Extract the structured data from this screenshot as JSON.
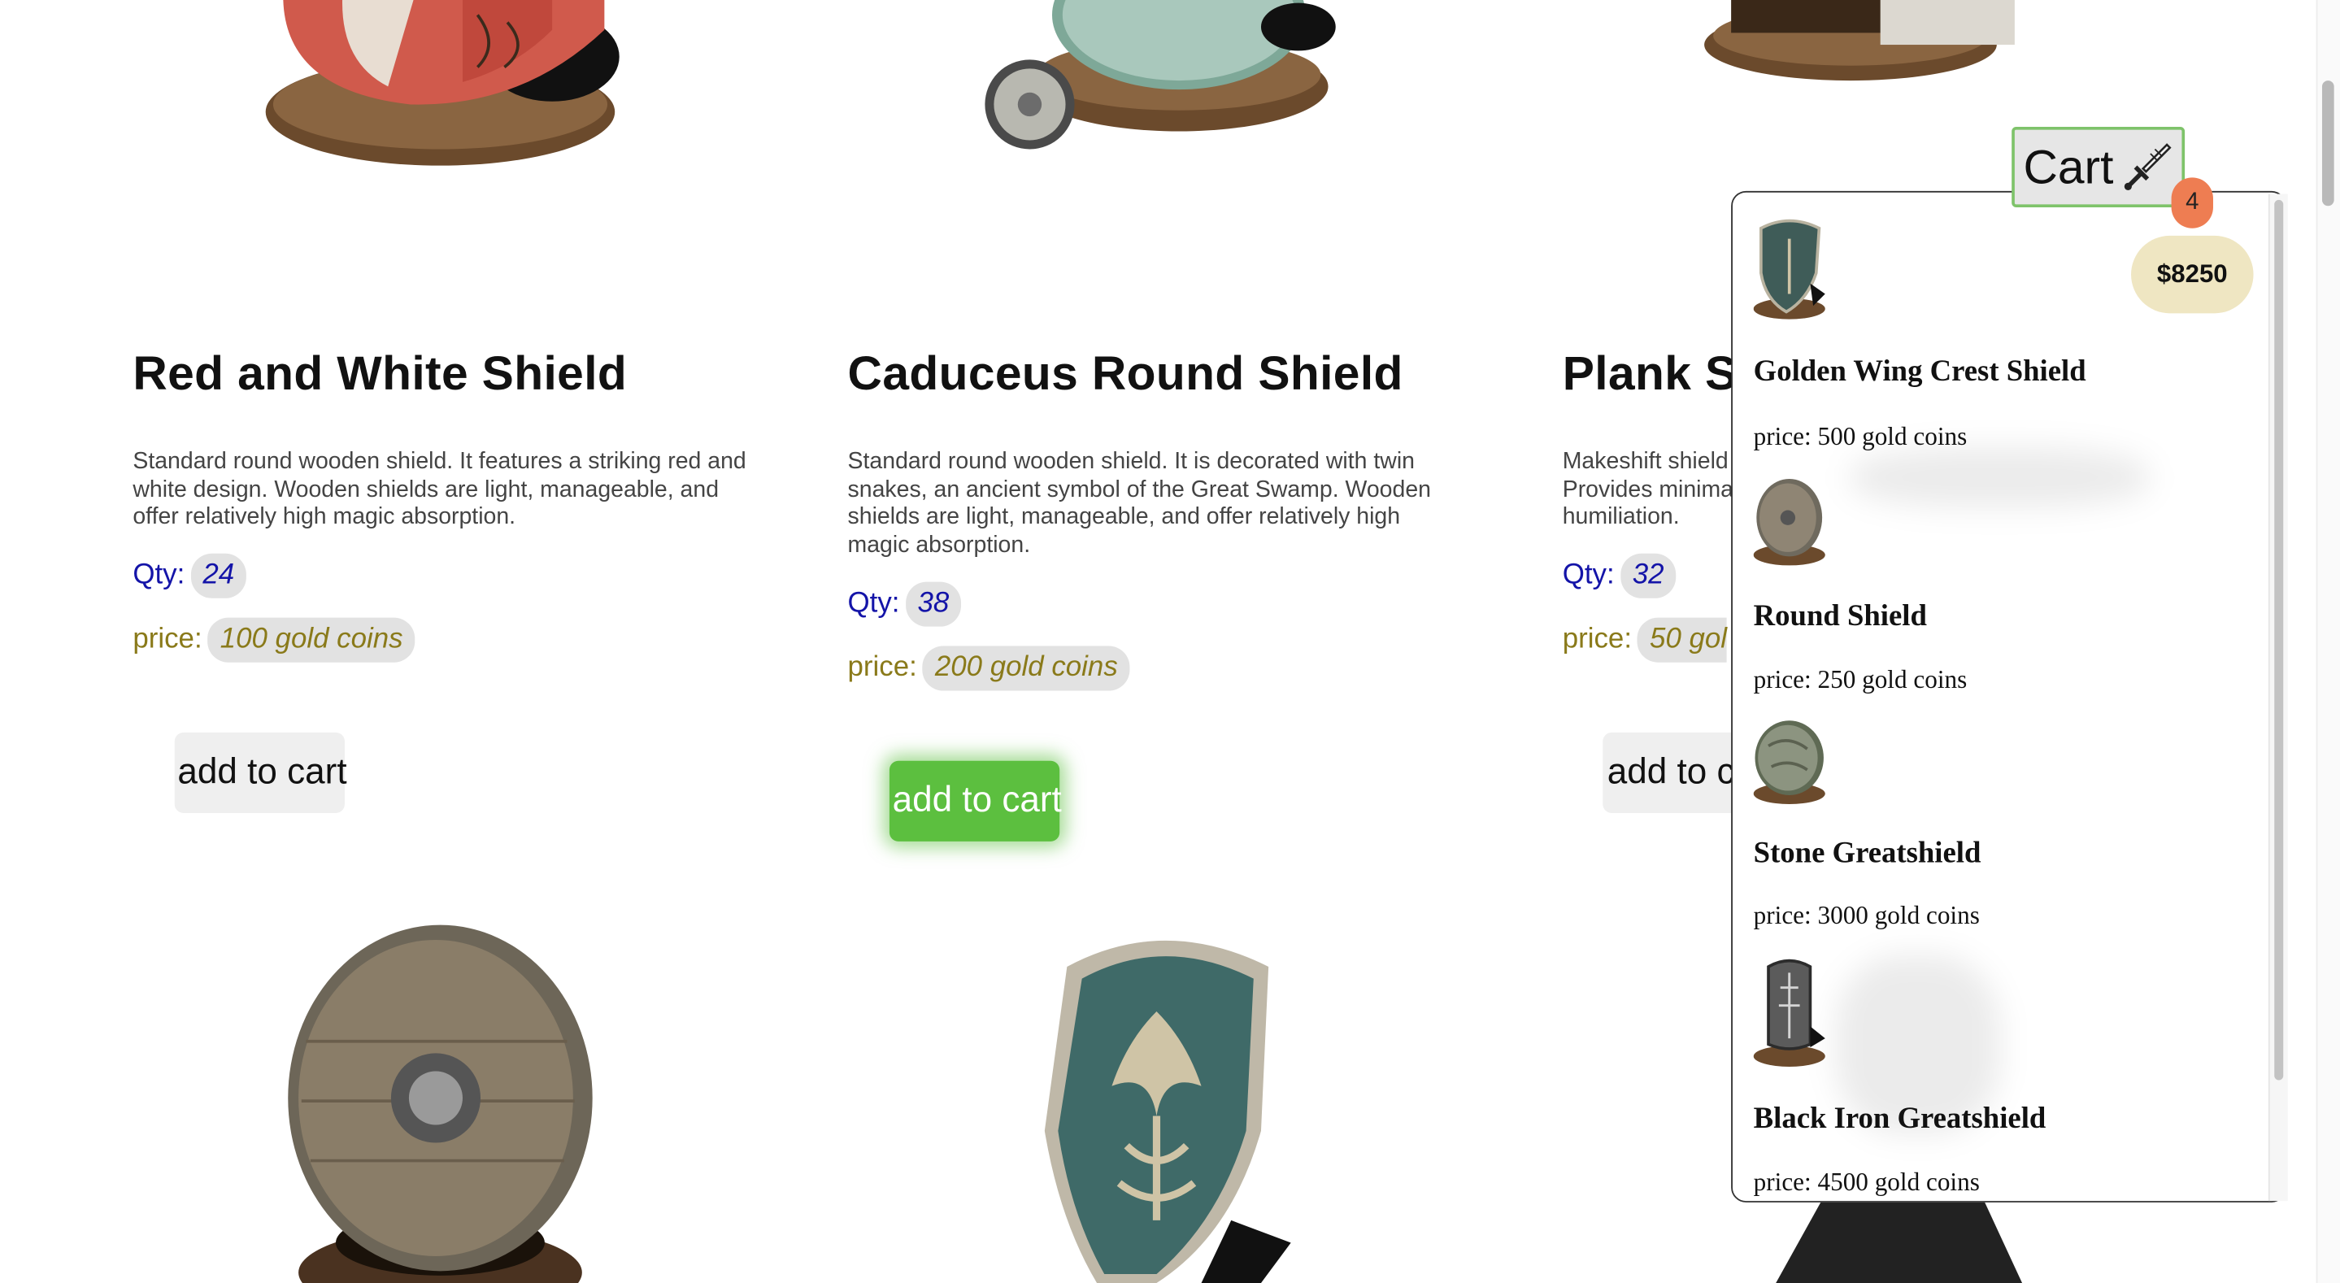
{
  "products": [
    {
      "title": "Red and White Shield",
      "description": "Standard round wooden shield. It features a striking red and white design. Wooden shields are light, manageable, and offer relatively high magic absorption.",
      "qty_label": "Qty:",
      "qty": "24",
      "price_label": "price:",
      "price": "100 gold coins",
      "button": "add to cart"
    },
    {
      "title": "Caduceus Round Shield",
      "description": "Standard round wooden shield. It is decorated with twin snakes, an ancient symbol of the Great Swamp. Wooden shields are light, manageable, and offer relatively high magic absorption.",
      "qty_label": "Qty:",
      "qty": "38",
      "price_label": "price:",
      "price": "200 gold coins",
      "button": "add to cart"
    },
    {
      "title": "Plank Sh",
      "description_lines": [
        "Makeshift shield",
        "Provides minima",
        "humiliation."
      ],
      "qty_label": "Qty:",
      "qty": "32",
      "price_label": "price:",
      "price": "50 gol",
      "button": "add to c"
    }
  ],
  "cart": {
    "label": "Cart",
    "icon": "sword-icon",
    "count": "4",
    "total": "$8250",
    "items": [
      {
        "name": "Golden Wing Crest Shield",
        "price": "price: 500 gold coins",
        "icon": "crest-shield-thumb"
      },
      {
        "name": "Round Shield",
        "price": "price: 250 gold coins",
        "icon": "round-shield-thumb"
      },
      {
        "name": "Stone Greatshield",
        "price": "price: 3000 gold coins",
        "icon": "stone-shield-thumb"
      },
      {
        "name": "Black Iron Greatshield",
        "price": "price: 4500 gold coins",
        "icon": "iron-greatshield-thumb"
      }
    ]
  },
  "colors": {
    "qty": "#1414a8",
    "price": "#8a7a1a",
    "active_button": "#5cbf3f",
    "cart_badge": "#ee7d52",
    "cart_total_bg": "#efe6c2",
    "cart_border": "#7ec36a"
  }
}
